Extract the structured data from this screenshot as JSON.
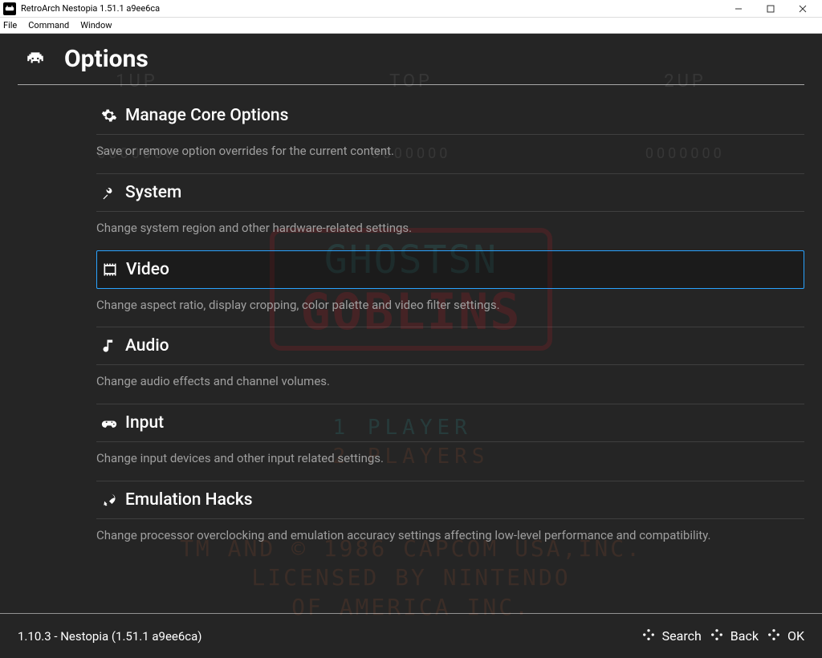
{
  "window": {
    "title": "RetroArch Nestopia 1.51.1 a9ee6ca"
  },
  "menubar": [
    "File",
    "Command",
    "Window"
  ],
  "page": {
    "title": "Options"
  },
  "options": [
    {
      "id": "manage-core",
      "label": "Manage Core Options",
      "desc": "Save or remove option overrides for the current content.",
      "selected": false
    },
    {
      "id": "system",
      "label": "System",
      "desc": "Change system region and other hardware-related settings.",
      "selected": false
    },
    {
      "id": "video",
      "label": "Video",
      "desc": "Change aspect ratio, display cropping, color palette and video filter settings.",
      "selected": true
    },
    {
      "id": "audio",
      "label": "Audio",
      "desc": "Change audio effects and channel volumes.",
      "selected": false
    },
    {
      "id": "input",
      "label": "Input",
      "desc": "Change input devices and other input related settings.",
      "selected": false
    },
    {
      "id": "emu-hacks",
      "label": "Emulation Hacks",
      "desc": "Change processor overclocking and emulation accuracy settings affecting low-level performance and compatibility.",
      "selected": false
    }
  ],
  "footer": {
    "version": "1.10.3 - Nestopia (1.51.1 a9ee6ca)",
    "actions": {
      "search": "Search",
      "back": "Back",
      "ok": "OK"
    }
  },
  "ghost_game": {
    "hud": {
      "p1": "1UP",
      "top": "TOP",
      "p2": "2UP",
      "score": "0000000"
    },
    "title_line1": "GHOSTSN",
    "title_line2": "GOBLINS",
    "menu1": "1 PLAYER",
    "menu2": "2 PLAYERS",
    "legal": "TM AND © 1986 CAPCOM USA,INC.\nLICENSED BY NINTENDO\nOF AMERICA INC."
  }
}
